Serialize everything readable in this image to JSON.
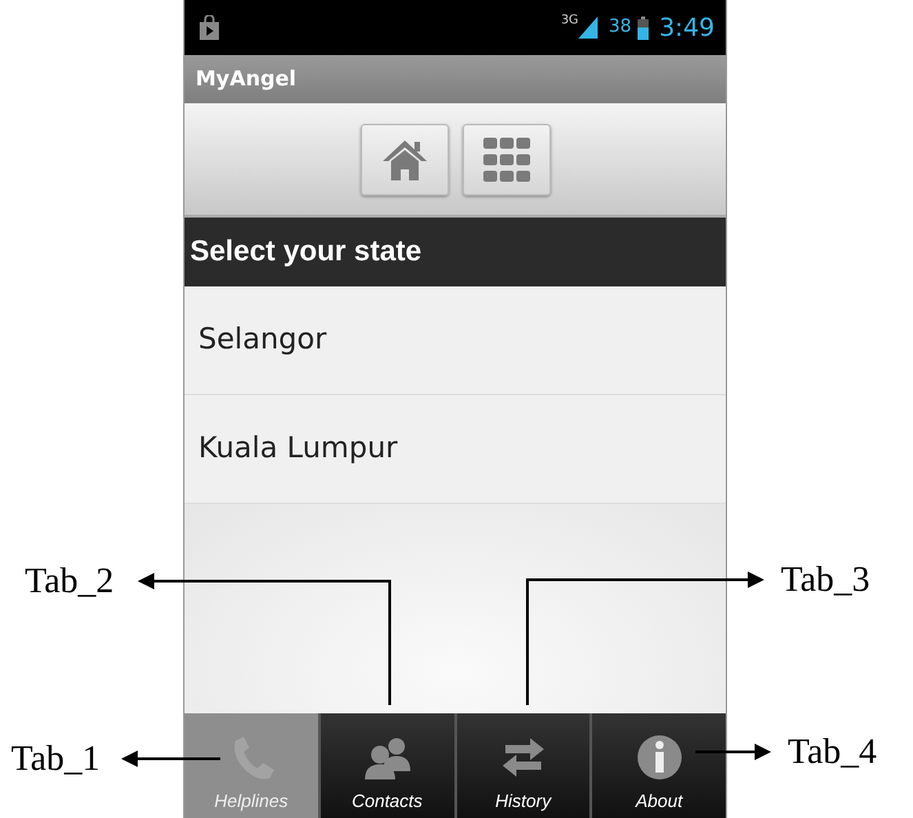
{
  "status_bar": {
    "network": "3G",
    "battery": "38",
    "time": "3:49"
  },
  "app_title": "MyAngel",
  "section_header": "Select your state",
  "states": [
    {
      "label": "Selangor"
    },
    {
      "label": "Kuala Lumpur"
    }
  ],
  "tabs": [
    {
      "label": "Helplines",
      "selected": true
    },
    {
      "label": "Contacts",
      "selected": false
    },
    {
      "label": "History",
      "selected": false
    },
    {
      "label": "About",
      "selected": false
    }
  ],
  "annotations": [
    {
      "label": "Tab_2"
    },
    {
      "label": "Tab_3"
    },
    {
      "label": "Tab_1"
    },
    {
      "label": "Tab_4"
    }
  ]
}
